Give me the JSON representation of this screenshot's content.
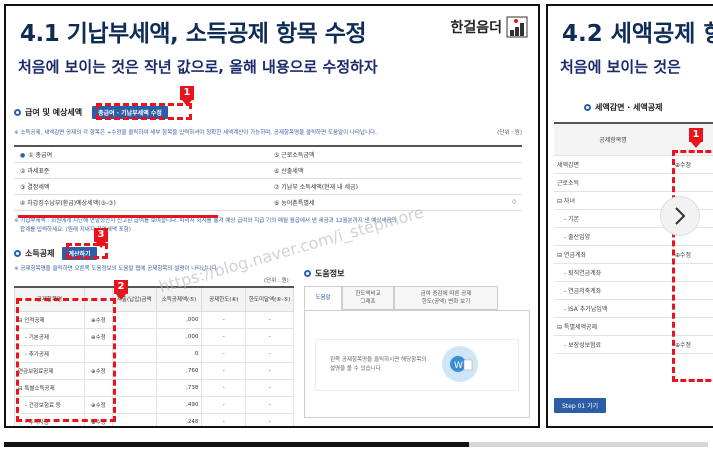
{
  "slide1": {
    "title": "4.1 기납부세액, 소득공제 항목 수정",
    "brand": "한걸음더",
    "subtitle": "처음에 보이는 것은 작년 값으로, 올해 내용으로 수정하자",
    "section1": {
      "title": "급여 및 예상세액",
      "button": "총급여 · 기납부세액 수정",
      "note": "※ 소득공제, 세액감면 공제의 각 항목은 +수정을 클릭하여 세부 항목을 입력하셔야 정확한 세액계산이 가능하며, 공제항목명을 클릭하면 도움말이 나타납니다.",
      "unit": "(단위 : 원)",
      "rows": [
        {
          "l1": "① 총급여",
          "l2": "⑤ 근로소득금액"
        },
        {
          "l1": "② 과세표준",
          "l2": "⑥ 산출세액"
        },
        {
          "l1": "③ 결정세액",
          "l2": "⑦ 기납부 소득세액(현재 내 세금)"
        },
        {
          "l1": "④ 차감징수납부(환급)예상세액(③-⑦)",
          "l2": "⑧ 농어촌특별세",
          "v2": "0"
        }
      ],
      "footnote1": "※ 기납부세액 : 회원에게 지난해 연말정산시 신고된 급여를 보여줍니다. 따라서 회사를 옮겨 예상 급여와 지급 기의 매월 월급에서 낸 세금과 12월분까지 낸 예상세금의",
      "footnote2": "합계를 입력하세요. (원래 지내지 끝연세액 포함)"
    },
    "section2": {
      "title": "소득공제",
      "button": "계산하기",
      "note": "※ 공제항목명을 클릭하면 오른쪽 도움정보의 도움말 탭에 공제항목의 설명이 나타납니다.",
      "unit": "(단위 : 원)",
      "headers": [
        "공제항목명",
        "",
        "지출(납입)금액",
        "소득공제액(⑤)",
        "공제한도(⑥)",
        "한도미달액(⑥-⑤)"
      ],
      "rows": [
        {
          "name": "⊟ 인적공제",
          "edit": "⊕수정",
          "amount": "",
          "deduct": ",000",
          "limit": "-",
          "gap": "-"
        },
        {
          "name": "- 기본공제",
          "edit": "⊕수정",
          "amount": "",
          "deduct": ",000",
          "limit": "-",
          "gap": "-"
        },
        {
          "name": "- 추가공제",
          "edit": "",
          "amount": "",
          "deduct": "0",
          "limit": "-",
          "gap": "-"
        },
        {
          "name": "연금보험료공제",
          "edit": "⊕수정",
          "amount": "",
          "deduct": ",760",
          "limit": "-",
          "gap": "-"
        },
        {
          "name": "⊟ 특별소득공제",
          "edit": "",
          "amount": "",
          "deduct": ",738",
          "limit": "-",
          "gap": "-"
        },
        {
          "name": "- 건강보험료 등",
          "edit": "⊕수정",
          "amount": "",
          "deduct": ",490",
          "limit": "-",
          "gap": "-"
        },
        {
          "name": "- 주택자금",
          "edit": "⊕수정",
          "amount": "",
          "deduct": ",248",
          "limit": "-",
          "gap": "-"
        }
      ]
    },
    "help": {
      "title": "도움정보",
      "tabs": [
        "도움말",
        "한도액비교\n그래프",
        "금여 증감에 따른 공제\n한도(공액) 변화 보기"
      ],
      "text": "왼쪽 공제항목명을 클릭하시면 해당항목의 설명을 볼 수 있습니다."
    },
    "badges": [
      "1",
      "2",
      "3"
    ],
    "watermark": "https://blog.naver.com/i_stepmore"
  },
  "slide2": {
    "title": "4.2 세액공제 항",
    "subtitle": "처음에 보이는 것은",
    "section": "세액감면 · 세액공제",
    "header": "공제항목명",
    "rows": [
      {
        "name": "세액감면",
        "edit": "⊕수정"
      },
      {
        "name": "근로소득",
        "edit": ""
      },
      {
        "name": "⊟ 자녀",
        "edit": ""
      },
      {
        "name": "- 기본",
        "edit": ""
      },
      {
        "name": "- 출산입양",
        "edit": ""
      },
      {
        "name": "⊟ 연금계좌",
        "edit": "⊕수정"
      },
      {
        "name": "- 퇴직연금계좌",
        "edit": ""
      },
      {
        "name": "- 연금저축계좌",
        "edit": ""
      },
      {
        "name": "- ISA 추가납입액",
        "edit": ""
      },
      {
        "name": "⊟ 특별세액공제",
        "edit": ""
      },
      {
        "name": "- 보장성보험료",
        "edit": "⊕수정"
      }
    ],
    "button": "Step 01 가기",
    "badge": "1",
    "next_icon": "chevron-right-icon"
  },
  "progress": 0.66,
  "colors": {
    "accent": "#2c5ea8",
    "highlight": "#e8141d",
    "title": "#0f2c56"
  }
}
